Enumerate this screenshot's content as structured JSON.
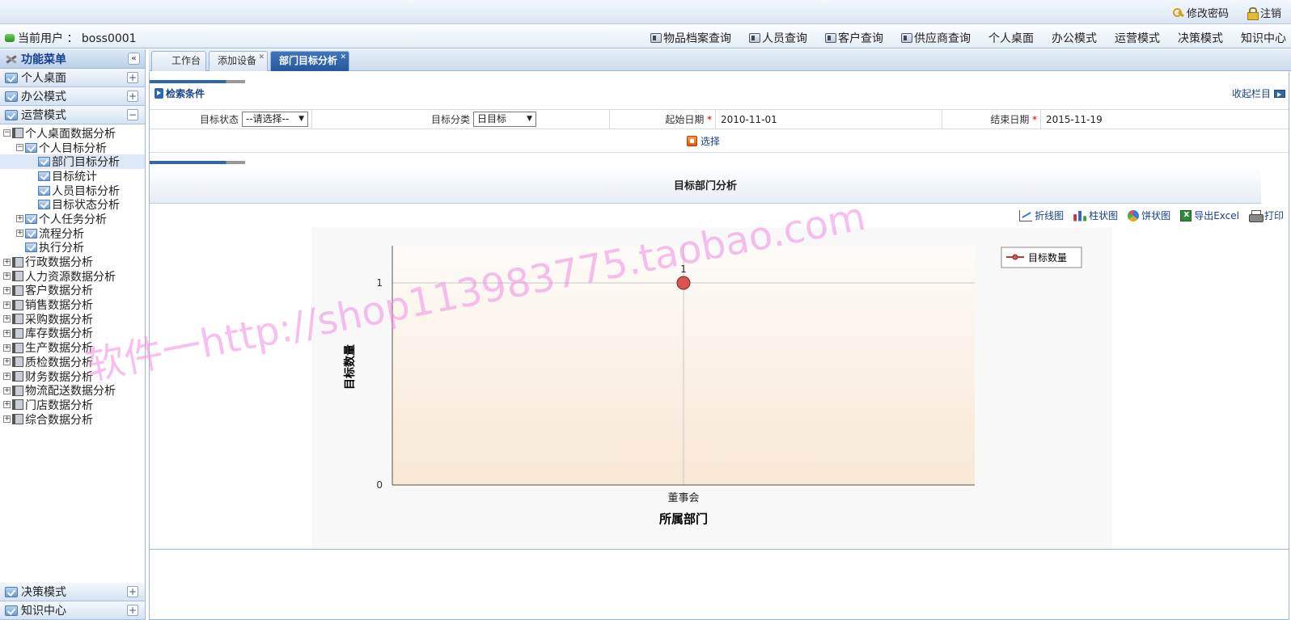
{
  "topbar": {
    "change_password": "修改密码",
    "logout": "注销"
  },
  "navbar": {
    "user_label": "当前用户 ： boss0001",
    "menu": [
      {
        "label": "物品档案查询",
        "icon": "card-icon"
      },
      {
        "label": "人员查询",
        "icon": "card-icon"
      },
      {
        "label": "客户查询",
        "icon": "card-icon"
      },
      {
        "label": "供应商查询",
        "icon": "card-icon"
      },
      {
        "label": "个人桌面"
      },
      {
        "label": "办公模式"
      },
      {
        "label": "运营模式"
      },
      {
        "label": "决策模式"
      },
      {
        "label": "知识中心"
      }
    ]
  },
  "sidebar": {
    "title": "功能菜单",
    "collapse": "«",
    "sections_top": [
      {
        "label": "个人桌面",
        "toggle": "+"
      },
      {
        "label": "办公模式",
        "toggle": "+"
      },
      {
        "label": "运营模式",
        "toggle": "−"
      }
    ],
    "tree": [
      {
        "label": "个人桌面数据分析",
        "level": 0,
        "toggle": "⊟",
        "icon": "book"
      },
      {
        "label": "个人目标分析",
        "level": 1,
        "toggle": "⊟",
        "icon": "check"
      },
      {
        "label": "部门目标分析",
        "level": 2,
        "toggle": "",
        "icon": "check",
        "selected": true
      },
      {
        "label": "目标统计",
        "level": 2,
        "toggle": "",
        "icon": "check"
      },
      {
        "label": "人员目标分析",
        "level": 2,
        "toggle": "",
        "icon": "check"
      },
      {
        "label": "目标状态分析",
        "level": 2,
        "toggle": "",
        "icon": "check"
      },
      {
        "label": "个人任务分析",
        "level": 1,
        "toggle": "⊞",
        "icon": "check"
      },
      {
        "label": "流程分析",
        "level": 1,
        "toggle": "⊞",
        "icon": "check"
      },
      {
        "label": "执行分析",
        "level": 1,
        "toggle": "",
        "icon": "check"
      },
      {
        "label": "行政数据分析",
        "level": 0,
        "toggle": "⊞",
        "icon": "book"
      },
      {
        "label": "人力资源数据分析",
        "level": 0,
        "toggle": "⊞",
        "icon": "book"
      },
      {
        "label": "客户数据分析",
        "level": 0,
        "toggle": "⊞",
        "icon": "book"
      },
      {
        "label": "销售数据分析",
        "level": 0,
        "toggle": "⊞",
        "icon": "book"
      },
      {
        "label": "采购数据分析",
        "level": 0,
        "toggle": "⊞",
        "icon": "book"
      },
      {
        "label": "库存数据分析",
        "level": 0,
        "toggle": "⊞",
        "icon": "book"
      },
      {
        "label": "生产数据分析",
        "level": 0,
        "toggle": "⊞",
        "icon": "book"
      },
      {
        "label": "质检数据分析",
        "level": 0,
        "toggle": "⊞",
        "icon": "book"
      },
      {
        "label": "财务数据分析",
        "level": 0,
        "toggle": "⊞",
        "icon": "book"
      },
      {
        "label": "物流配送数据分析",
        "level": 0,
        "toggle": "⊞",
        "icon": "book"
      },
      {
        "label": "门店数据分析",
        "level": 0,
        "toggle": "⊞",
        "icon": "book"
      },
      {
        "label": "综合数据分析",
        "level": 0,
        "toggle": "⊞",
        "icon": "book"
      }
    ],
    "sections_bottom": [
      {
        "label": "决策模式",
        "toggle": "+"
      },
      {
        "label": "知识中心",
        "toggle": "+"
      }
    ]
  },
  "tabs": [
    {
      "label": "工作台",
      "closable": false,
      "active": false
    },
    {
      "label": "添加设备",
      "closable": true,
      "active": false
    },
    {
      "label": "部门目标分析",
      "closable": true,
      "active": true
    }
  ],
  "search": {
    "title": "检索条件",
    "collapse_link": "收起栏目",
    "status_label": "目标状态",
    "status_value": "--请选择--",
    "category_label": "目标分类",
    "category_value": "日目标",
    "start_label": "起始日期",
    "start_value": "2010-11-01",
    "end_label": "结束日期",
    "end_value": "2015-11-19",
    "required_mark": "*",
    "select_button": "选择"
  },
  "chart_section": {
    "title": "目标部门分析",
    "tools": [
      {
        "label": "折线图",
        "icon": "line-chart-icon"
      },
      {
        "label": "柱状图",
        "icon": "bar-chart-icon"
      },
      {
        "label": "饼状图",
        "icon": "pie-chart-icon"
      },
      {
        "label": "导出Excel",
        "icon": "excel-icon"
      },
      {
        "label": "打印",
        "icon": "print-icon"
      }
    ]
  },
  "chart_data": {
    "type": "line",
    "categories": [
      "董事会"
    ],
    "series": [
      {
        "name": "目标数量",
        "values": [
          1
        ],
        "color": "#d9534f"
      }
    ],
    "xlabel": "所属部门",
    "ylabel": "目标数量",
    "ylim": [
      0,
      1
    ],
    "yticks": [
      0,
      1
    ],
    "data_labels": true,
    "grid": true,
    "legend": "top-right"
  },
  "watermark": "软件一http://shop113983775.taobao.com"
}
